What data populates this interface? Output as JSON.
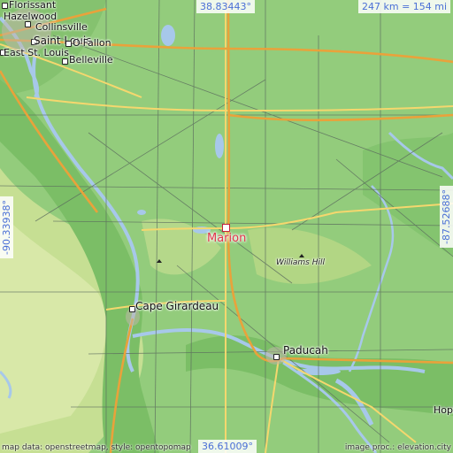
{
  "map": {
    "target_city": "Marion",
    "coordinates": {
      "top": "38.83443°",
      "bottom": "36.61009°",
      "left": "-90.33938°",
      "right": "-87.52688°"
    },
    "scale": "247 km = 154 mi",
    "places": [
      {
        "name": "Florissant"
      },
      {
        "name": "Hazelwood"
      },
      {
        "name": "Collinsville"
      },
      {
        "name": "Saint Louis"
      },
      {
        "name": "O'Fallon"
      },
      {
        "name": "East St. Louis"
      },
      {
        "name": "Belleville"
      },
      {
        "name": "Cape Girardeau"
      },
      {
        "name": "Paducah"
      },
      {
        "name": "Hopk"
      }
    ],
    "features": [
      {
        "name": "Williams Hill"
      }
    ],
    "attribution_left": "map data: openstreetmap, style: opentopomap",
    "attribution_right": "image proc.: elevation.city",
    "colors": {
      "lowland": "#8fc97a",
      "highland": "#d9e9a5",
      "water": "#a7c8ea",
      "motorway": "#e9a23b",
      "primary_road": "#f5d76e",
      "accent": "#e0354a"
    }
  }
}
